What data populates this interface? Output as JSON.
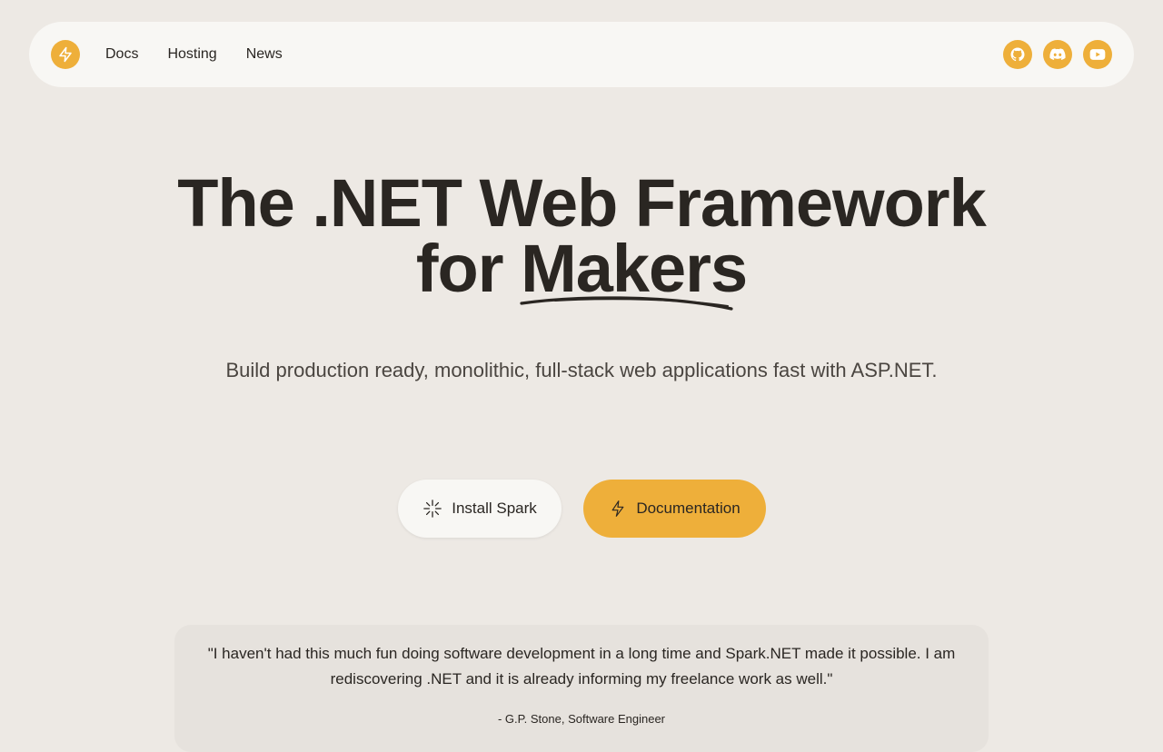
{
  "nav": {
    "logo_icon": "bolt-icon",
    "links": [
      "Docs",
      "Hosting",
      "News"
    ],
    "social": [
      "github-icon",
      "discord-icon",
      "youtube-icon"
    ],
    "accent": "#eeaf3a"
  },
  "hero": {
    "title_line1": "The .NET Web Framework",
    "title_for": "for",
    "title_highlight": "Makers",
    "subtitle": "Build production ready, monolithic, full-stack web applications fast with ASP.NET."
  },
  "actions": {
    "install_label": "Install Spark",
    "install_icon": "sparkle-icon",
    "docs_label": "Documentation",
    "docs_icon": "bolt-icon"
  },
  "testimonial": {
    "quote": "\"I haven't had this much fun doing software development in a long time and Spark.NET made it possible. I am rediscovering .NET and it is already informing my freelance work as well.\"",
    "author": "- G.P. Stone, Software Engineer"
  },
  "colors": {
    "background": "#ede9e4",
    "surface": "#f8f7f4",
    "text": "#2a2622"
  }
}
